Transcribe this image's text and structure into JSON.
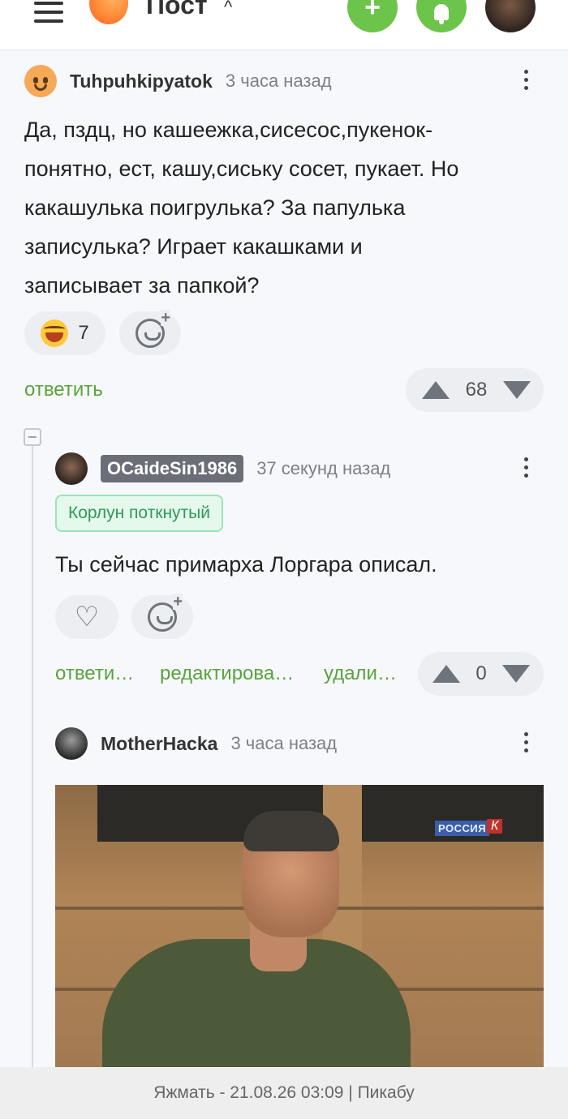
{
  "header": {
    "title": "Пост",
    "caret": "^",
    "plus_label": "+"
  },
  "comments": [
    {
      "author": "Tuhpuhkipyatok",
      "time": "3 часа назад",
      "text_lines": [
        "Да, пздц, но кашеежка,сисесос,пукенок-",
        "понятно, ест, кашу,сиську сосет, пукает. Но",
        "какашулька поигрулька? За папулька",
        "записулька? Играет какашками и",
        "записывает за папкой?"
      ],
      "reaction_count": "7",
      "reply_label": "ответить",
      "rating": "68"
    },
    {
      "author": "OCaideSin1986",
      "time": "37 секунд назад",
      "tag": "Корлун поткнутый",
      "text": "Ты сейчас примарха Лоргара описал.",
      "reply_label": "ответи…",
      "edit_label": "редактирова…",
      "delete_label": "удали…",
      "rating": "0"
    },
    {
      "author": "MotherHacka",
      "time": "3 часа назад",
      "media_watermark": "РОССИЯ",
      "media_watermark_k": "К"
    }
  ],
  "footer": {
    "text": "Яжмать - 21.08.26 03:09 | Пикабу"
  }
}
